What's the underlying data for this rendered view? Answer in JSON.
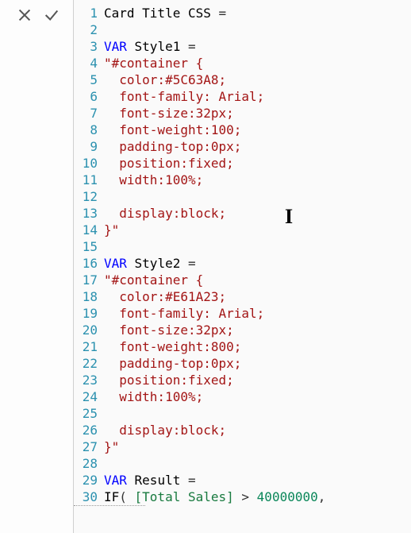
{
  "toolbar": {
    "cancel": "Cancel",
    "accept": "Accept"
  },
  "cursor_glyph": "I",
  "lines": [
    {
      "n": 1,
      "tokens": [
        {
          "c": "ident",
          "t": "Card Title CSS "
        },
        {
          "c": "op",
          "t": "="
        }
      ]
    },
    {
      "n": 2,
      "tokens": []
    },
    {
      "n": 3,
      "tokens": [
        {
          "c": "keyword",
          "t": "VAR"
        },
        {
          "c": "ident",
          "t": " Style1 "
        },
        {
          "c": "op",
          "t": "="
        }
      ]
    },
    {
      "n": 4,
      "tokens": [
        {
          "c": "string",
          "t": "\"#container {"
        }
      ]
    },
    {
      "n": 5,
      "tokens": [
        {
          "c": "string",
          "t": "  color:#5C63A8;"
        }
      ]
    },
    {
      "n": 6,
      "tokens": [
        {
          "c": "string",
          "t": "  font-family: Arial;"
        }
      ]
    },
    {
      "n": 7,
      "tokens": [
        {
          "c": "string",
          "t": "  font-size:32px;"
        }
      ]
    },
    {
      "n": 8,
      "tokens": [
        {
          "c": "string",
          "t": "  font-weight:100;"
        }
      ]
    },
    {
      "n": 9,
      "tokens": [
        {
          "c": "string",
          "t": "  padding-top:0px;"
        }
      ]
    },
    {
      "n": 10,
      "tokens": [
        {
          "c": "string",
          "t": "  position:fixed;"
        }
      ]
    },
    {
      "n": 11,
      "tokens": [
        {
          "c": "string",
          "t": "  width:100%;"
        }
      ]
    },
    {
      "n": 12,
      "tokens": []
    },
    {
      "n": 13,
      "tokens": [
        {
          "c": "string",
          "t": "  display:block;"
        }
      ]
    },
    {
      "n": 14,
      "tokens": [
        {
          "c": "string",
          "t": "}\""
        }
      ]
    },
    {
      "n": 15,
      "tokens": []
    },
    {
      "n": 16,
      "tokens": [
        {
          "c": "keyword",
          "t": "VAR"
        },
        {
          "c": "ident",
          "t": " Style2 "
        },
        {
          "c": "op",
          "t": "="
        }
      ]
    },
    {
      "n": 17,
      "tokens": [
        {
          "c": "string",
          "t": "\"#container {"
        }
      ]
    },
    {
      "n": 18,
      "tokens": [
        {
          "c": "string",
          "t": "  color:#E61A23;"
        }
      ]
    },
    {
      "n": 19,
      "tokens": [
        {
          "c": "string",
          "t": "  font-family: Arial;"
        }
      ]
    },
    {
      "n": 20,
      "tokens": [
        {
          "c": "string",
          "t": "  font-size:32px;"
        }
      ]
    },
    {
      "n": 21,
      "tokens": [
        {
          "c": "string",
          "t": "  font-weight:800;"
        }
      ]
    },
    {
      "n": 22,
      "tokens": [
        {
          "c": "string",
          "t": "  padding-top:0px;"
        }
      ]
    },
    {
      "n": 23,
      "tokens": [
        {
          "c": "string",
          "t": "  position:fixed;"
        }
      ]
    },
    {
      "n": 24,
      "tokens": [
        {
          "c": "string",
          "t": "  width:100%;"
        }
      ]
    },
    {
      "n": 25,
      "tokens": []
    },
    {
      "n": 26,
      "tokens": [
        {
          "c": "string",
          "t": "  display:block;"
        }
      ]
    },
    {
      "n": 27,
      "tokens": [
        {
          "c": "string",
          "t": "}\""
        }
      ]
    },
    {
      "n": 28,
      "tokens": []
    },
    {
      "n": 29,
      "tokens": [
        {
          "c": "keyword",
          "t": "VAR"
        },
        {
          "c": "ident",
          "t": " Result "
        },
        {
          "c": "op",
          "t": "="
        }
      ]
    },
    {
      "n": 30,
      "tokens": [
        {
          "c": "func",
          "t": "IF"
        },
        {
          "c": "op",
          "t": "( "
        },
        {
          "c": "col",
          "t": "[Total Sales]"
        },
        {
          "c": "op",
          "t": " > "
        },
        {
          "c": "number",
          "t": "40000000"
        },
        {
          "c": "op",
          "t": ","
        }
      ]
    }
  ]
}
